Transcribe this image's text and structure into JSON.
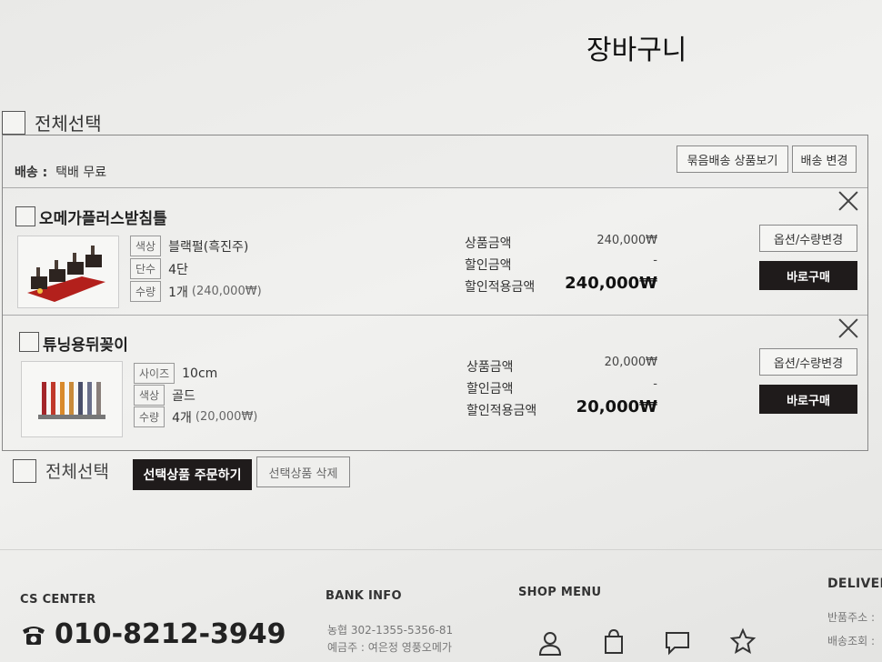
{
  "page": {
    "title": "장바구니"
  },
  "select_all_label": "전체선택",
  "shipping": {
    "label_prefix": "배송 :",
    "label_value": "택배 무료",
    "bundle_button": "묶음배송 상품보기",
    "change_button": "배송 변경"
  },
  "items": [
    {
      "name": "오메가플러스받침틀",
      "options": [
        {
          "tag": "색상",
          "value": "블랙펄(흑진주)",
          "sub": ""
        },
        {
          "tag": "단수",
          "value": "4단",
          "sub": ""
        },
        {
          "tag": "수량",
          "value": "1개",
          "sub": "(240,000₩)"
        }
      ],
      "price_labels": [
        "상품금액",
        "할인금액",
        "할인적용금액"
      ],
      "product_price": "240,000₩",
      "discount": "-",
      "final_price": "240,000₩",
      "option_button": "옵션/수량변경",
      "buy_button": "바로구매"
    },
    {
      "name": "튜닝용뒤꽂이",
      "options": [
        {
          "tag": "사이즈",
          "value": "10cm",
          "sub": ""
        },
        {
          "tag": "색상",
          "value": "골드",
          "sub": ""
        },
        {
          "tag": "수량",
          "value": "4개",
          "sub": "(20,000₩)"
        }
      ],
      "price_labels": [
        "상품금액",
        "할인금액",
        "할인적용금액"
      ],
      "product_price": "20,000₩",
      "discount": "-",
      "final_price": "20,000₩",
      "option_button": "옵션/수량변경",
      "buy_button": "바로구매"
    }
  ],
  "actions": {
    "order_selected": "선택상품 주문하기",
    "delete_selected": "선택상품 삭제"
  },
  "footer": {
    "cs_title": "CS CENTER",
    "phone": "010-8212-3949",
    "bank_title": "BANK INFO",
    "bank_account": "농협 302-1355-5356-81",
    "bank_holder": "예금주 : 여은정 영풍오메가",
    "shop_title": "SHOP MENU",
    "shop_icons": [
      "user-icon",
      "shopping-bag-icon",
      "chat-bubble-icon",
      "star-icon"
    ],
    "delivery_title": "DELIVER",
    "delivery_lines": [
      "반품주소 :",
      "배송조회 :"
    ]
  }
}
